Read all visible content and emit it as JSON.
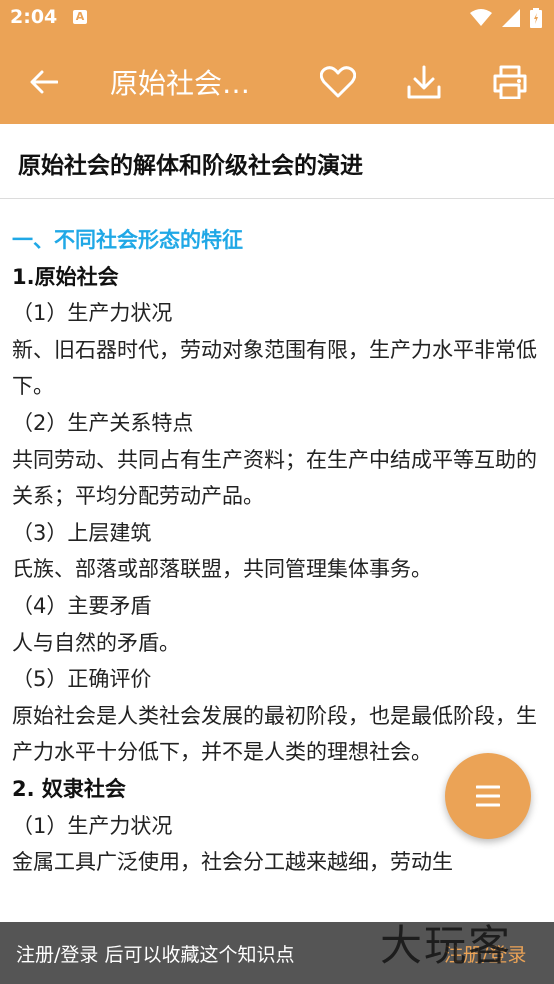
{
  "status": {
    "time": "2:04"
  },
  "appbar": {
    "title": "原始社会…"
  },
  "article": {
    "title": "原始社会的解体和阶级社会的演进"
  },
  "content": {
    "section1_heading": "一、不同社会形态的特征",
    "primitive_heading": "1.原始社会",
    "p1_label": "（1）生产力状况",
    "p1_text": "新、旧石器时代，劳动对象范围有限，生产力水平非常低下。",
    "p2_label": "（2）生产关系特点",
    "p2_text": "共同劳动、共同占有生产资料；在生产中结成平等互助的关系；平均分配劳动产品。",
    "p3_label": "（3）上层建筑",
    "p3_text": "氏族、部落或部落联盟，共同管理集体事务。",
    "p4_label": "（4）主要矛盾",
    "p4_text": "人与自然的矛盾。",
    "p5_label": "（5）正确评价",
    "p5_text": "原始社会是人类社会发展的最初阶段，也是最低阶段，生产力水平十分低下，并不是人类的理想社会。",
    "slavery_heading": "2. 奴隶社会",
    "s1_label": "（1）生产力状况",
    "s1_text": "金属工具广泛使用，社会分工越来越细，劳动生"
  },
  "bottom": {
    "message": "注册/登录 后可以收藏这个知识点",
    "action": "注册/登录",
    "watermark": "大玩客"
  },
  "colors": {
    "accent": "#eba356",
    "heading": "#20a8e6"
  },
  "icons": [
    "back-arrow-icon",
    "heart-icon",
    "download-icon",
    "print-icon",
    "menu-icon",
    "wifi-icon",
    "signal-icon",
    "battery-icon"
  ]
}
